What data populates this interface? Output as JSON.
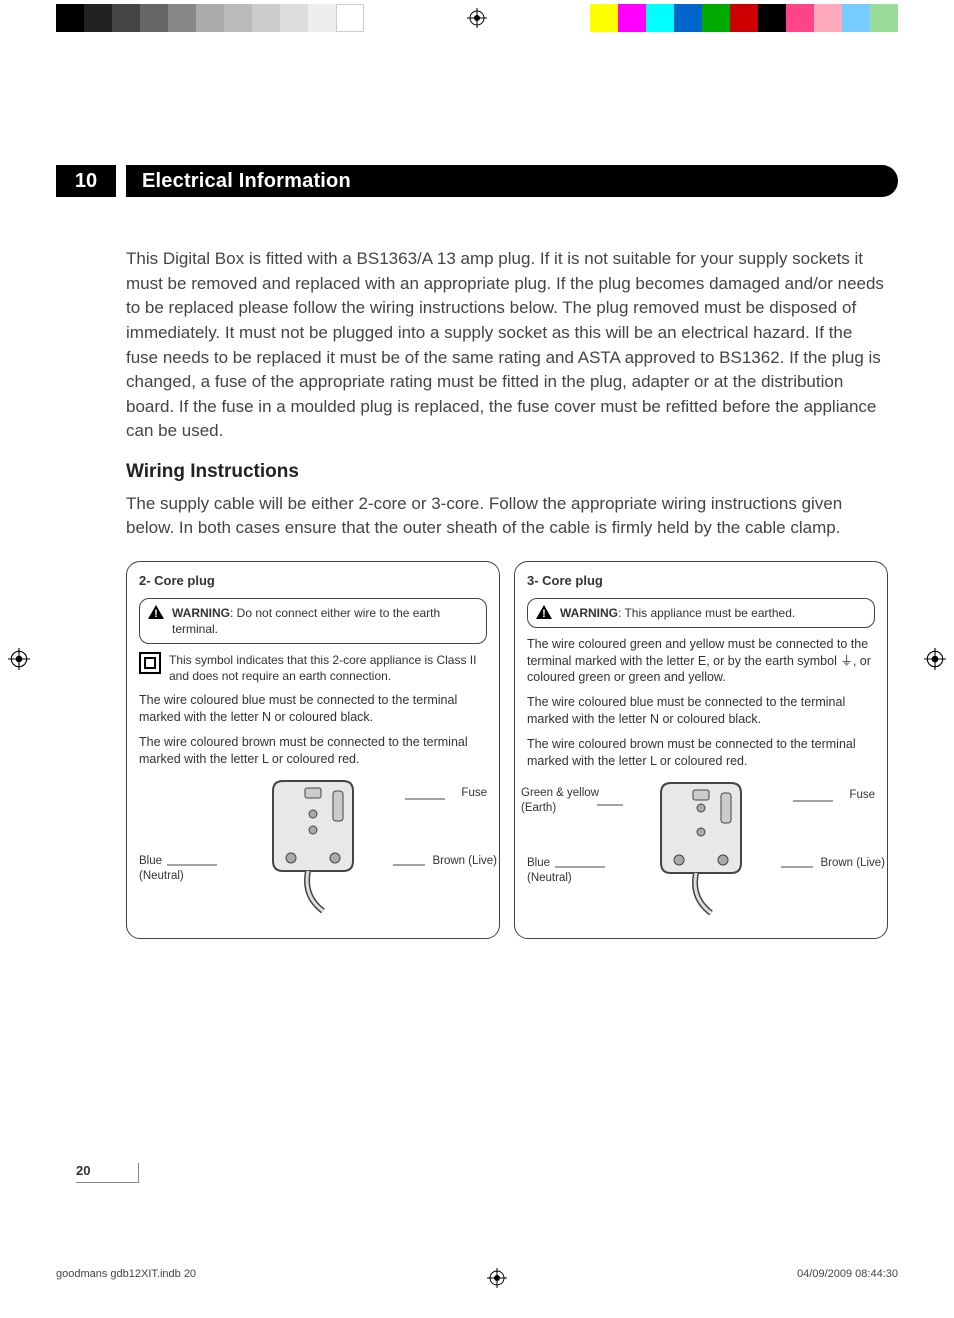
{
  "section_number": "10",
  "section_title": "Electrical Information",
  "intro": "This Digital Box is fitted with a BS1363/A 13 amp plug. If it is not suitable for your supply sockets it must be removed and replaced with an appropriate plug. If the plug becomes damaged and/or needs to be replaced please follow the wiring instructions below. The plug removed must be disposed of immediately. It must not be plugged into a supply socket as this will be an electrical hazard. If the fuse needs to be replaced it must be of the same rating and ASTA approved to BS1362. If the plug is changed, a fuse of the appropriate rating must be fitted in the plug, adapter or at the distribution board. If the fuse in a moulded plug is replaced, the fuse cover must be refitted before the appliance can be used.",
  "wiring_heading": "Wiring Instructions",
  "wiring_intro": "The supply cable will be either 2-core or 3-core. Follow the appropriate wiring instructions given below. In both cases ensure that the outer sheath of the cable is firmly held by the cable clamp.",
  "panel2": {
    "title": "2- Core plug",
    "warning_label": "WARNING",
    "warning_text": ": Do not connect either wire to the earth terminal.",
    "class2_text": "This symbol indicates that this 2-core appliance is Class II and does not require an earth connection.",
    "blue_text": "The wire coloured blue must be connected to the terminal marked with the letter N or coloured black.",
    "brown_text": "The wire coloured brown must be connected to the terminal marked with the letter L or coloured red.",
    "label_fuse": "Fuse",
    "label_blue": "Blue\n(Neutral)",
    "label_brown": "Brown (Live)"
  },
  "panel3": {
    "title": "3- Core plug",
    "warning_label": "WARNING",
    "warning_text": ": This appliance must be earthed.",
    "earth_text": "The wire coloured green and yellow must be connected to the terminal marked with the letter E, or by the earth symbol ⏚, or coloured green or green and yellow.",
    "blue_text": "The wire coloured blue must be connected to the terminal marked with the letter N or coloured black.",
    "brown_text": "The wire coloured brown must be connected to the terminal marked with the letter L or coloured red.",
    "label_fuse": "Fuse",
    "label_earth": "Green & yellow\n(Earth)",
    "label_blue": "Blue\n(Neutral)",
    "label_brown": "Brown (Live)"
  },
  "footer": {
    "page": "20",
    "file": "goodmans gdb12XIT.indb   20",
    "date": "04/09/2009   08:44:30"
  }
}
